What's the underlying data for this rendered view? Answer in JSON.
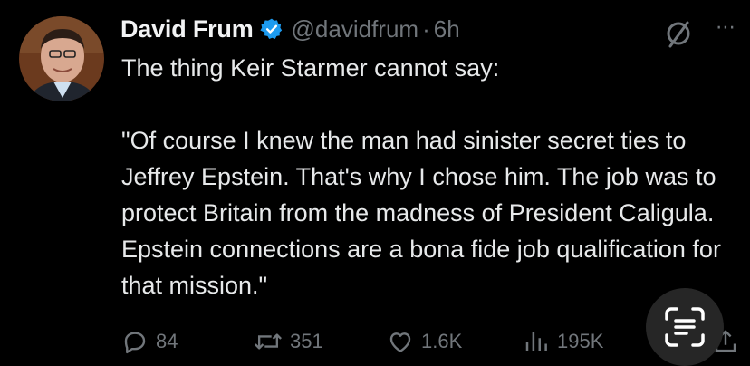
{
  "tweet": {
    "author_name": "David Frum",
    "handle": "@davidfrum",
    "separator": "·",
    "time": "6h",
    "text": "The thing Keir Starmer cannot say:\n\n\"Of course I knew the man had sinister secret ties to Jeffrey Epstein. That's why I chose him. The job was to protect Britain from the madness of President Caligula. Epstein connections are a bona fide job qualification for that mission.\""
  },
  "header_icons": {
    "grok": "grok-icon",
    "more": "⋯"
  },
  "actions": {
    "replies": "84",
    "reposts": "351",
    "likes": "1.6K",
    "views": "195K"
  },
  "colors": {
    "background": "#000000",
    "text": "#e7e9ea",
    "muted": "#71767b",
    "verified": "#1d9bf0"
  }
}
